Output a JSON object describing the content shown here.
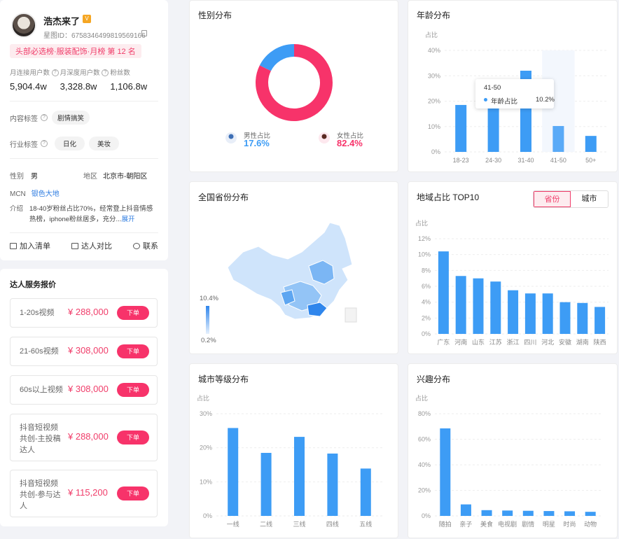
{
  "profile": {
    "name": "浩杰来了",
    "uid": "星图ID：6758346499819569166",
    "rank_badge": "头部必选榜·服装配饰·月榜 第 12 名",
    "stats": [
      {
        "label": "月连接用户数",
        "value": "5,904.4w"
      },
      {
        "label": "月深度用户数",
        "value": "3,328.8w"
      },
      {
        "label": "粉丝数",
        "value": "1,106.8w"
      }
    ],
    "content_tags_label": "内容标签",
    "content_tags": [
      "剧情搞笑"
    ],
    "industry_tags_label": "行业标签",
    "industry_tags": [
      "日化",
      "美妆"
    ],
    "gender_label": "性别",
    "gender_value": "男",
    "region_label": "地区",
    "region_value": "北京市-朝阳区",
    "mcn_label": "MCN",
    "mcn_value": "银色大地",
    "intro_label": "介绍",
    "intro_text": "18-40岁粉丝占比70%，经常登上抖音情感热榜，iphone粉丝居多，充分...",
    "intro_more": "展开",
    "actions": [
      "加入清单",
      "达人对比",
      "联系"
    ]
  },
  "pricing": {
    "title": "达人服务报价",
    "button_label": "下单",
    "items": [
      {
        "label": "1-20s视频",
        "price": "¥ 288,000"
      },
      {
        "label": "21-60s视频",
        "price": "¥ 308,000"
      },
      {
        "label": "60s以上视频",
        "price": "¥ 308,000"
      },
      {
        "label": "抖音短视频共创-主投稿达人",
        "price": "¥ 288,000"
      },
      {
        "label": "抖音短视频共创-参与达人",
        "price": "¥ 115,200"
      }
    ]
  },
  "gender_chart": {
    "title": "性别分布",
    "male_label": "男性占比",
    "male_value": "17.6%",
    "female_label": "女性占比",
    "female_value": "82.4%"
  },
  "map_card": {
    "title": "全国省份分布",
    "legend_max": "10.4%",
    "legend_min": "0.2%"
  },
  "region_toggle": {
    "options": [
      "省份",
      "城市"
    ],
    "active": "省份"
  },
  "tooltip": {
    "title": "41-50",
    "series": "年龄占比",
    "value": "10.2%"
  },
  "colors": {
    "accent": "#f03d6a",
    "bar": "#3d9cf5",
    "male": "#3d9cf5",
    "female": "#f7336a"
  },
  "chart_data": [
    {
      "type": "pie",
      "title": "性别分布",
      "categories": [
        "男性占比",
        "女性占比"
      ],
      "values": [
        17.6,
        82.4
      ]
    },
    {
      "type": "bar",
      "title": "年龄分布",
      "ylabel": "占比",
      "categories": [
        "18-23",
        "24-30",
        "31-40",
        "41-50",
        "50+"
      ],
      "values": [
        18.5,
        18.5,
        32,
        10.2,
        6.3
      ],
      "ylim": [
        0,
        40
      ],
      "yticks": [
        "0%",
        "10%",
        "20%",
        "30%",
        "40%"
      ],
      "highlight_index": 3
    },
    {
      "type": "bar",
      "title": "地域占比 TOP10",
      "ylabel": "占比",
      "categories": [
        "广东",
        "河南",
        "山东",
        "江苏",
        "浙江",
        "四川",
        "河北",
        "安徽",
        "湖南",
        "陕西"
      ],
      "values": [
        10.4,
        7.3,
        7.0,
        6.6,
        5.5,
        5.1,
        5.1,
        4.0,
        3.9,
        3.4
      ],
      "ylim": [
        0,
        12
      ],
      "yticks": [
        "0%",
        "2%",
        "4%",
        "6%",
        "8%",
        "10%",
        "12%"
      ]
    },
    {
      "type": "bar",
      "title": "城市等级分布",
      "ylabel": "占比",
      "categories": [
        "一线",
        "二线",
        "三线",
        "四线",
        "五线"
      ],
      "values": [
        25.8,
        18.5,
        23.2,
        18.3,
        13.9
      ],
      "ylim": [
        0,
        30
      ],
      "yticks": [
        "0%",
        "10%",
        "20%",
        "30%"
      ]
    },
    {
      "type": "bar",
      "title": "兴趣分布",
      "ylabel": "占比",
      "categories": [
        "随拍",
        "亲子",
        "美食",
        "电视剧",
        "剧情",
        "明星",
        "时尚",
        "动物"
      ],
      "values": [
        68.5,
        9,
        4.5,
        4.2,
        4,
        3.8,
        3.6,
        3.2
      ],
      "ylim": [
        0,
        80
      ],
      "yticks": [
        "0%",
        "20%",
        "40%",
        "60%",
        "80%"
      ]
    }
  ]
}
